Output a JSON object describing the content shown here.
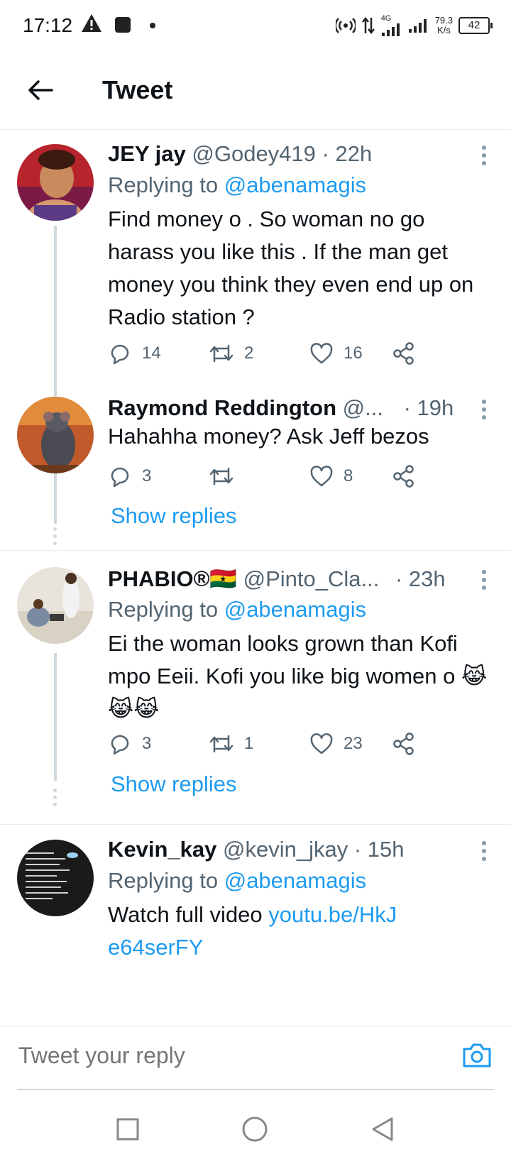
{
  "status_bar": {
    "time": "17:12",
    "speed_value": "79.3",
    "speed_unit": "K/s",
    "network": "4G",
    "battery": "42"
  },
  "app_bar": {
    "title": "Tweet"
  },
  "tweets": [
    {
      "name": "JEY jay",
      "handle": "@Godey419",
      "time": "· 22h",
      "replying_prefix": "Replying to",
      "replying_to": "@abenamagis",
      "text": "Find money o . So woman no go harass you like this . If the man get money you think they even end up on Radio station ?",
      "replies": "14",
      "retweets": "2",
      "likes": "16"
    },
    {
      "name": "Raymond Reddington",
      "handle": "@...",
      "time": "· 19h",
      "text": "Hahahha money? Ask Jeff bezos",
      "replies": "3",
      "retweets": "",
      "likes": "8",
      "show_replies": "Show replies"
    },
    {
      "name": "PHABIO®🇬🇭",
      "handle": "@Pinto_Cla...",
      "time": "· 23h",
      "replying_prefix": "Replying to",
      "replying_to": "@abenamagis",
      "text": "Ei the woman looks grown than Kofi mpo Eeii. Kofi you like big women o 😹😹😹",
      "replies": "3",
      "retweets": "1",
      "likes": "23",
      "show_replies": "Show replies"
    },
    {
      "name": "Kevin_kay",
      "handle": "@kevin_jkay",
      "time": "· 15h",
      "replying_prefix": "Replying to",
      "replying_to": "@abenamagis",
      "text": "Watch full video",
      "link": "youtu.be/HkJe64serFY"
    }
  ],
  "composer": {
    "placeholder": "Tweet your reply"
  },
  "colors": {
    "accent": "#1d9bf0",
    "secondary_text": "#536471",
    "thread_line": "#cfd9de"
  }
}
